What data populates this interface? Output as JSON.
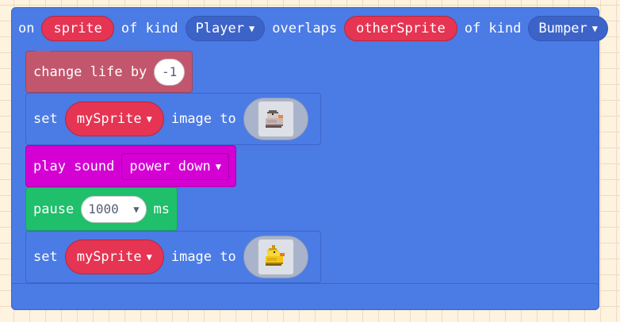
{
  "event_block": {
    "on_label": "on",
    "sprite_var": "sprite",
    "of_kind_label_1": "of kind",
    "kind_1": "Player",
    "overlaps_label": "overlaps",
    "other_sprite_var": "otherSprite",
    "of_kind_label_2": "of kind",
    "kind_2": "Bumper",
    "color": "#4b7be5"
  },
  "statements": {
    "change_life": {
      "label": "change life by",
      "value": "-1",
      "color": "#c2566d"
    },
    "set_image_1": {
      "set_label": "set",
      "variable": "mySprite",
      "image_to_label": "image to",
      "image_icon": "gray-duck-sprite-icon",
      "color": "#4b7be5"
    },
    "play_sound": {
      "label": "play sound",
      "sound": "power down",
      "color": "#d400d4"
    },
    "pause": {
      "label": "pause",
      "duration": "1000",
      "unit": "ms",
      "color": "#20bf6b"
    },
    "set_image_2": {
      "set_label": "set",
      "variable": "mySprite",
      "image_to_label": "image to",
      "image_icon": "yellow-duck-sprite-icon",
      "color": "#4b7be5"
    }
  },
  "icons": {
    "dropdown": "caret-down-icon"
  }
}
